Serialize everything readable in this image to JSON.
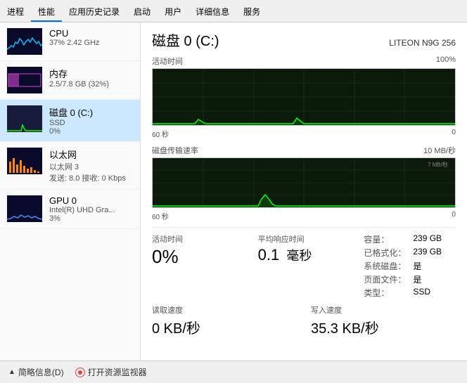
{
  "menu": {
    "items": [
      "进程",
      "性能",
      "应用历史记录",
      "启动",
      "用户",
      "详细信息",
      "服务"
    ]
  },
  "sidebar": {
    "items": [
      {
        "id": "cpu",
        "title": "CPU",
        "subtitle1": "37% 2.42 GHz",
        "subtitle2": "",
        "chart_type": "cpu"
      },
      {
        "id": "memory",
        "title": "内存",
        "subtitle1": "2.5/7.8 GB (32%)",
        "subtitle2": "",
        "chart_type": "ram"
      },
      {
        "id": "disk",
        "title": "磁盘 0 (C:)",
        "subtitle1": "SSD",
        "subtitle2": "0%",
        "chart_type": "disk",
        "active": true
      },
      {
        "id": "ethernet",
        "title": "以太网",
        "subtitle1": "以太网 3",
        "subtitle2": "发送: 8.0 接收: 0 Kbps",
        "chart_type": "eth"
      },
      {
        "id": "gpu",
        "title": "GPU 0",
        "subtitle1": "Intel(R) UHD Gra...",
        "subtitle2": "3%",
        "chart_type": "gpu"
      }
    ]
  },
  "disk_panel": {
    "title": "磁盘 0 (C:)",
    "model": "LITEON N9G  256",
    "activity_label": "活动时间",
    "activity_max": "100%",
    "transfer_label": "磁盘传输速率",
    "transfer_max": "10 MB/秒",
    "transfer_current": "7 MB/秒",
    "time_60": "60 秒",
    "time_0": "0",
    "stats": {
      "activity_label": "活动时间",
      "activity_value": "0%",
      "response_label": "平均响应时间",
      "response_value": "0.1",
      "response_unit": "毫秒",
      "read_label": "读取速度",
      "read_value": "0 KB/秒",
      "write_label": "写入速度",
      "write_value": "35.3 KB/秒"
    },
    "info": {
      "capacity_label": "容量：",
      "capacity_value": "239 GB",
      "formatted_label": "已格式化：",
      "formatted_value": "239 GB",
      "system_label": "系统磁盘：",
      "system_value": "是",
      "pagefile_label": "页面文件：",
      "pagefile_value": "是",
      "type_label": "类型：",
      "type_value": "SSD"
    }
  },
  "footer": {
    "brief_label": "简略信息(D)",
    "monitor_label": "打开资源监视器"
  }
}
